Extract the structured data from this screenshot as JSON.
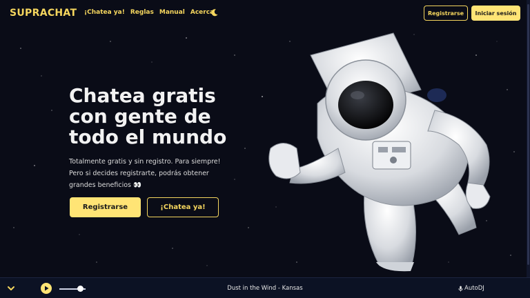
{
  "brand": {
    "name": "SUPRACHAT",
    "accent": "#f5d65e"
  },
  "nav": {
    "items": [
      "¡Chatea ya!",
      "Reglas",
      "Manual",
      "Acerca"
    ],
    "theme_icon": "moon-icon"
  },
  "header_actions": {
    "register": "Registrarse",
    "login": "Iniciar sesión"
  },
  "hero": {
    "title_line1": "Chatea gratis",
    "title_line2": "con gente de",
    "title_line3": "todo el mundo",
    "sub_line1": "Totalmente gratis y sin registro. Para siempre!",
    "sub_line2": "Pero si decides registrarte, podrás obtener",
    "sub_line3": "grandes beneficios 👀",
    "cta_register": "Registrarse",
    "cta_chat": "¡Chatea ya!"
  },
  "player": {
    "track": "Dust in the Wind - Kansas",
    "source": "AutoDJ",
    "play_icon": "play-icon",
    "collapse_icon": "chevron-down-icon",
    "mic_icon": "microphone-icon",
    "volume": 0.7
  }
}
